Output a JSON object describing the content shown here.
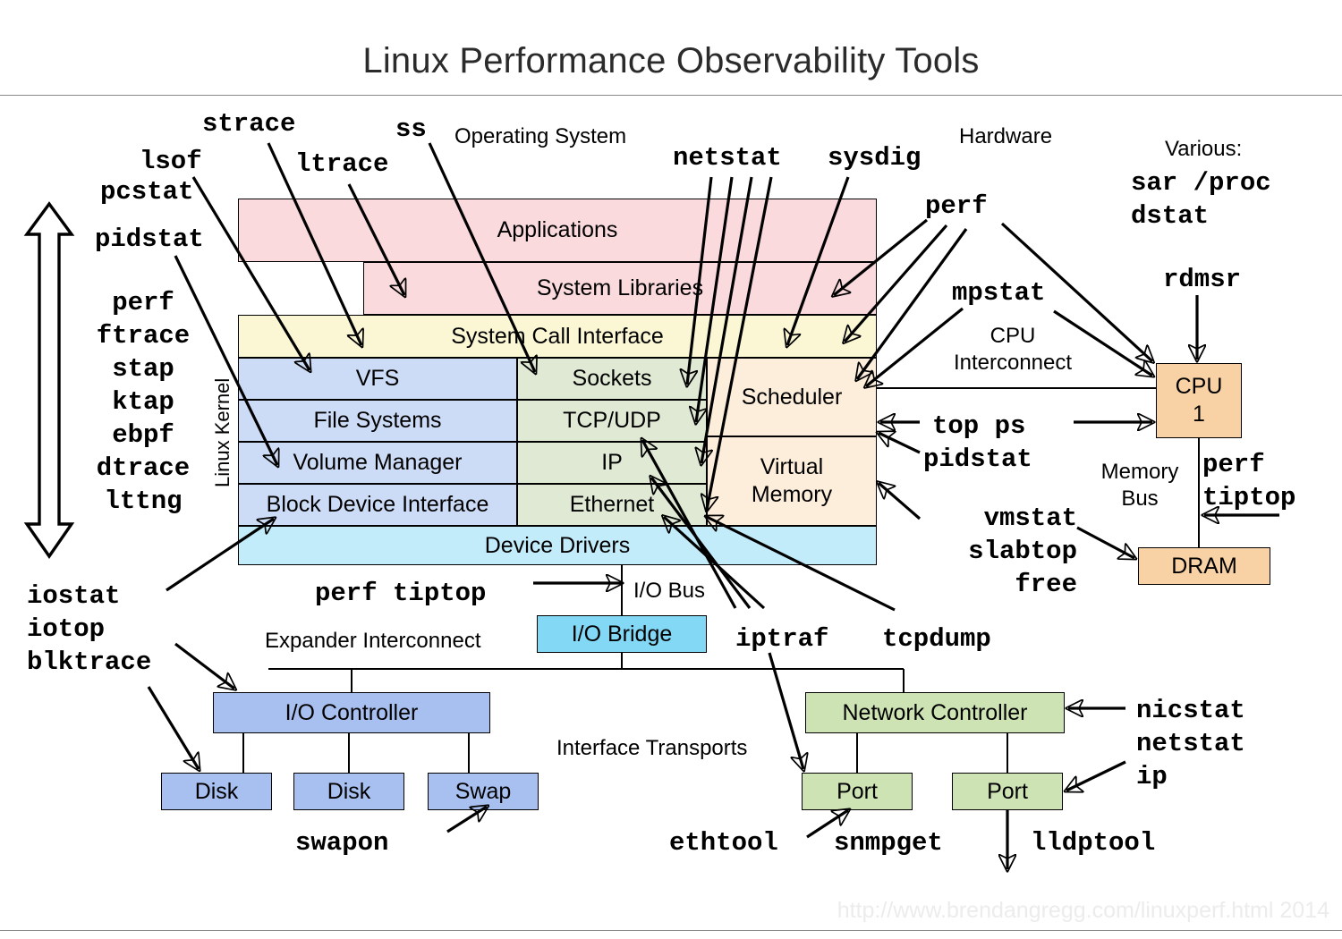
{
  "title": "Linux Performance Observability Tools",
  "footer": "http://www.brendangregg.com/linuxperf.html 2014",
  "regions": {
    "operating_system": "Operating System",
    "hardware": "Hardware",
    "various_label": "Various:",
    "linux_kernel": "Linux Kernel",
    "cpu_interconnect": "CPU\nInterconnect",
    "memory_bus": "Memory\nBus",
    "io_bus": "I/O Bus",
    "expander_interconnect": "Expander Interconnect",
    "interface_transports": "Interface Transports"
  },
  "stack": {
    "applications": "Applications",
    "system_libraries": "System Libraries",
    "system_call_interface": "System Call Interface",
    "file_column": [
      "VFS",
      "File Systems",
      "Volume Manager",
      "Block Device Interface"
    ],
    "net_column": [
      "Sockets",
      "TCP/UDP",
      "IP",
      "Ethernet"
    ],
    "other_column": [
      "Scheduler",
      "Virtual\nMemory"
    ],
    "device_drivers": "Device Drivers"
  },
  "hardware": {
    "cpu": "CPU\n1",
    "dram": "DRAM",
    "io_bridge": "I/O Bridge",
    "io_controller": "I/O Controller",
    "disk1": "Disk",
    "disk2": "Disk",
    "swap": "Swap",
    "network_controller": "Network Controller",
    "port1": "Port",
    "port2": "Port"
  },
  "tools": {
    "strace": "strace",
    "ss": "ss",
    "lsof": "lsof",
    "ltrace": "ltrace",
    "pcstat": "pcstat",
    "pidstat": "pidstat",
    "netstat": "netstat",
    "sysdig": "sysdig",
    "perf": "perf",
    "mpstat": "mpstat",
    "rdmsr": "rdmsr",
    "various_list": "sar /proc\ndstat",
    "kernel_tracers": "perf\nftrace\nstap\nktap\nebpf\ndtrace\nlttng",
    "iostat_group": "iostat\niotop\nblktrace",
    "top_ps": "top ps",
    "pidstat2": "pidstat",
    "vmstat_group": "vmstat\nslabtop\nfree",
    "perf_tiptop_mem": "perf\ntiptop",
    "perf_tiptop_bus": "perf tiptop",
    "iptraf": "iptraf",
    "tcpdump": "tcpdump",
    "nicstat_group": "nicstat\nnetstat\nip",
    "swapon": "swapon",
    "ethtool": "ethtool",
    "snmpget": "snmpget",
    "lldptool": "lldptool"
  },
  "colors": {
    "applications": "#fadadd",
    "syscall": "#fbf7d5",
    "file_column": "#cddcf6",
    "net_column": "#dfe9d3",
    "other_column": "#fdeedb",
    "device_drivers": "#c3ecfa",
    "io_bridge": "#82d8f5",
    "io_hardware": "#a8c0f0",
    "net_hardware": "#cde3b4",
    "cpu_hardware": "#f8d2a4",
    "outline": "#000000",
    "footer_text": "#ececec"
  }
}
